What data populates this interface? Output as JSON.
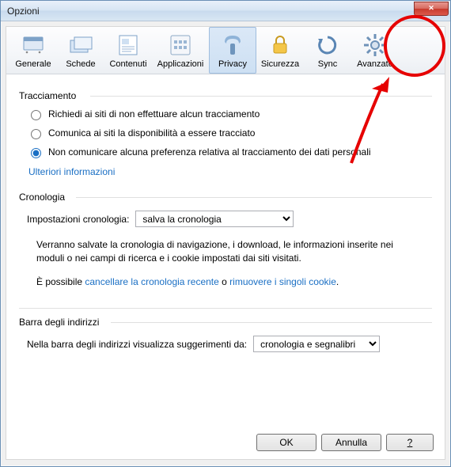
{
  "window": {
    "title": "Opzioni"
  },
  "toolbar": {
    "items": [
      {
        "label": "Generale"
      },
      {
        "label": "Schede"
      },
      {
        "label": "Contenuti"
      },
      {
        "label": "Applicazioni"
      },
      {
        "label": "Privacy"
      },
      {
        "label": "Sicurezza"
      },
      {
        "label": "Sync"
      },
      {
        "label": "Avanzate"
      }
    ]
  },
  "tracking": {
    "legend": "Tracciamento",
    "opt1": "Richiedi ai siti di non effettuare alcun tracciamento",
    "opt2": "Comunica ai siti la disponibilità a essere tracciato",
    "opt3": "Non comunicare alcuna preferenza relativa al tracciamento dei dati personali",
    "moreinfo": "Ulteriori informazioni"
  },
  "history": {
    "legend": "Cronologia",
    "settings_label": "Impostazioni cronologia:",
    "selected": "salva la cronologia",
    "desc1": "Verranno salvate la cronologia di navigazione, i download, le informazioni inserite nei moduli o nei campi di ricerca e i cookie impostati dai siti visitati.",
    "desc2_pre": "È possibile ",
    "desc2_link1": "cancellare la cronologia recente",
    "desc2_mid": " o ",
    "desc2_link2": "rimuovere i singoli cookie",
    "desc2_post": "."
  },
  "addressbar": {
    "legend": "Barra degli indirizzi",
    "label": "Nella barra degli indirizzi visualizza suggerimenti da:",
    "selected": "cronologia e segnalibri"
  },
  "buttons": {
    "ok": "OK",
    "cancel": "Annulla",
    "help": "?"
  }
}
